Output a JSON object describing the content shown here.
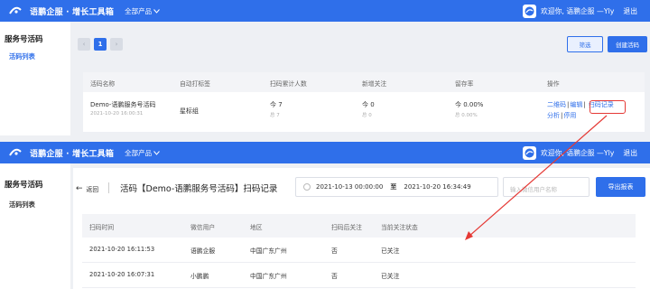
{
  "topbar": {
    "brand": "语鹏企服 · 增长工具箱",
    "products": "全部产品",
    "welcome_1": "欢迎你, 语鹏企服 —Yly",
    "welcome_2": "欢迎你, 语鹏企服 —Yly",
    "logout": "退出"
  },
  "screen1": {
    "sidebar": {
      "title": "服务号活码",
      "item": "活码列表"
    },
    "pager": {
      "prev": "‹",
      "current": "1",
      "next": "›"
    },
    "filter_button": "筛选",
    "create_button": "创建活码",
    "table": {
      "headers": [
        "活码名称",
        "自动打标签",
        "扫码累计人数",
        "新增关注",
        "留存率",
        "操作"
      ],
      "row": {
        "name": "Demo-语鹏服务号活码",
        "created": "2021-10-20 16:00:31",
        "tag": "星标组",
        "scans": "今 7",
        "scans_total": "总 7",
        "follows": "今 0",
        "follows_total": "总 0",
        "retention": "今 0.00%",
        "retention_total": "总 0.00%",
        "ops": {
          "qrcode": "二维码",
          "edit": "编辑",
          "scan_log": "扫码记录",
          "analysis": "分析",
          "disable": "停用",
          "sep": "|"
        }
      }
    }
  },
  "screen2": {
    "sidebar": {
      "title": "服务号活码",
      "item": "活码列表"
    },
    "back": "返回",
    "back_arrow": "←",
    "title": "活码【Demo-语鹏服务号活码】扫码记录",
    "date_start": "2021-10-13 00:00:00",
    "date_to": "至",
    "date_end": "2021-10-20 16:34:49",
    "search_placeholder": "输入微信用户名称",
    "export_button": "导出报表",
    "table": {
      "headers": [
        "扫码时间",
        "微信用户",
        "地区",
        "扫码后关注",
        "当前关注状态"
      ],
      "rows": [
        [
          "2021-10-20 16:11:53",
          "语鹏企服",
          "中国广东广州",
          "否",
          "已关注"
        ],
        [
          "2021-10-20 16:07:31",
          "小鹏鹏",
          "中国广东广州",
          "否",
          "已关注"
        ]
      ]
    }
  },
  "colors": {
    "primary": "#2f6fea",
    "highlight": "#e53935"
  }
}
